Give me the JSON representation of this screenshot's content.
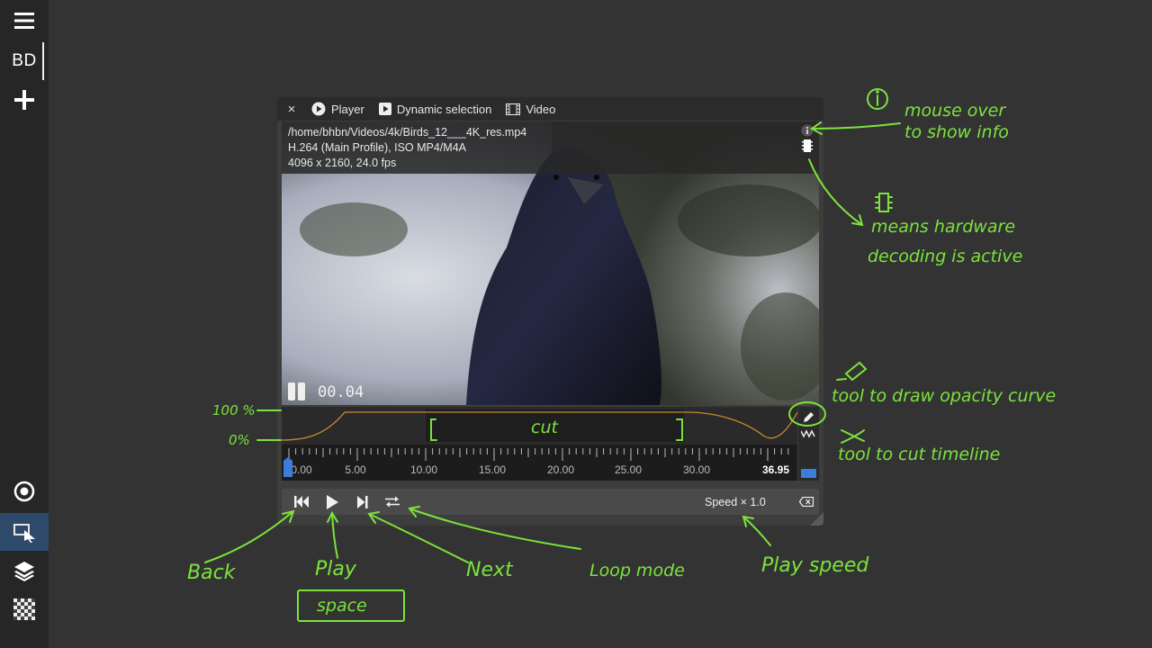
{
  "sidebar": {
    "menu_icon": "hamburger-icon",
    "workspace_label": "BD",
    "add_icon": "plus-icon",
    "bottom_icons": [
      "target-icon",
      "selection-tool-icon",
      "layers-icon",
      "checkerboard-icon"
    ]
  },
  "window": {
    "close_label": "×",
    "tabs": [
      {
        "icon": "play-circle-icon",
        "label": "Player"
      },
      {
        "icon": "play-square-icon",
        "label": "Dynamic selection"
      },
      {
        "icon": "film-icon",
        "label": "Video"
      }
    ]
  },
  "video": {
    "path": "/home/bhbn/Videos/4k/Birds_12___4K_res.mp4",
    "codec": "H.264 (Main Profile), ISO MP4/M4A",
    "resolution": "4096 x 2160, 24.0 fps",
    "timecode": "00.04",
    "info_icon": "info-icon",
    "hw_icon": "chip-icon"
  },
  "timeline": {
    "cut_label": "cut",
    "ticks": [
      "0.00",
      "5.00",
      "10.00",
      "15.00",
      "20.00",
      "25.00",
      "30.00"
    ],
    "end_time": "36.95",
    "draw_tool_icon": "pencil-icon",
    "cut_tool_icon": "waveform-icon"
  },
  "controls": {
    "back_icon": "skip-back-icon",
    "play_icon": "play-icon",
    "next_icon": "step-forward-icon",
    "loop_icon": "loop-icon",
    "speed_label": "Speed × 1.0",
    "reset_icon": "backspace-icon"
  },
  "annotations": {
    "info_line1": "mouse over",
    "info_line2": "to show info",
    "hw_line1": "means hardware",
    "hw_line2": "decoding is active",
    "pencil_line": "tool to draw opacity curve",
    "cut_line": "tool to cut timeline",
    "pct_100": "100 %",
    "pct_0": "0%",
    "back": "Back",
    "play": "Play",
    "space": "space",
    "next": "Next",
    "loop": "Loop mode",
    "speed": "Play speed"
  },
  "colors": {
    "accent": "#7be33c",
    "playhead": "#3b7ddd",
    "curve": "#c68a2e"
  }
}
